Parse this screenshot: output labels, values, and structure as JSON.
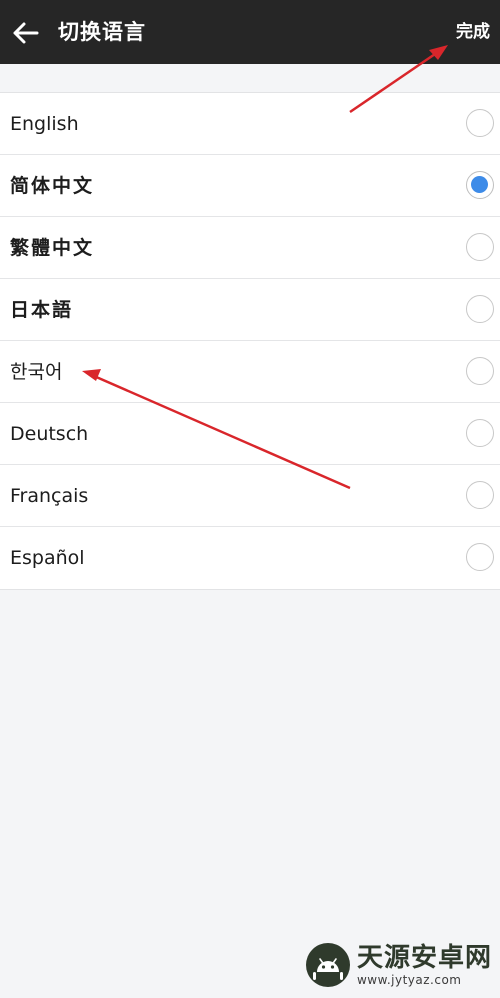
{
  "header": {
    "back_icon": "arrow-left-icon",
    "title": "切换语言",
    "done_label": "完成"
  },
  "languages": [
    {
      "label": "English",
      "selected": false
    },
    {
      "label": "简体中文",
      "selected": true
    },
    {
      "label": "繁體中文",
      "selected": false
    },
    {
      "label": "日本語",
      "selected": false
    },
    {
      "label": "한국어",
      "selected": false
    },
    {
      "label": "Deutsch",
      "selected": false
    },
    {
      "label": "Français",
      "selected": false
    },
    {
      "label": "Español",
      "selected": false
    }
  ],
  "colors": {
    "header_bg": "#262626",
    "radio_selected": "#3d8be8",
    "annotation_arrow": "#d9262b"
  },
  "watermark": {
    "name": "天源安卓网",
    "url": "www.jytyaz.com"
  }
}
